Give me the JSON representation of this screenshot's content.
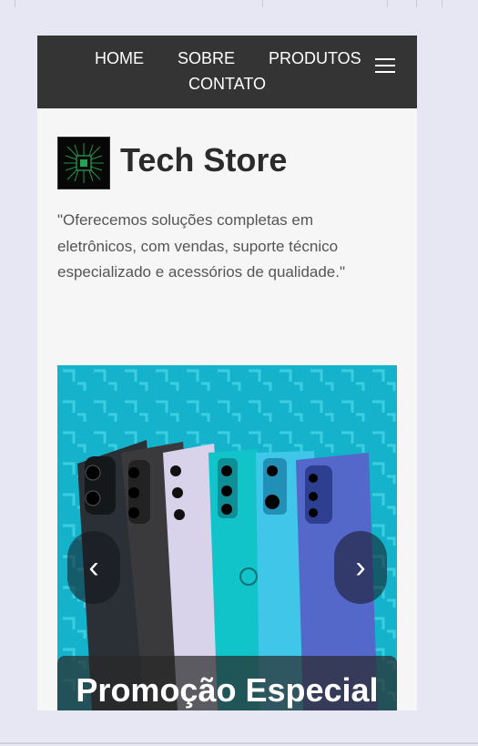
{
  "nav": {
    "items": [
      "HOME",
      "SOBRE",
      "PRODUTOS",
      "CONTATO"
    ],
    "menu_icon": "hamburger-icon"
  },
  "brand": {
    "logo_icon": "circuit-chip-icon",
    "name": "Tech Store"
  },
  "description": "\"Oferecemos soluções completas em eletrônicos, com vendas, suporte técnico especializado e acessórios de qualidade.\"",
  "carousel": {
    "prev_symbol": "‹",
    "next_symbol": "›",
    "caption_title": "Promoção Especial",
    "image": "smartphones-lineup"
  },
  "colors": {
    "navbar": "#343434",
    "page_bg": "#f6f6f6",
    "window_bg": "#e7e7f3",
    "carousel_bg": "#12b7cf"
  }
}
